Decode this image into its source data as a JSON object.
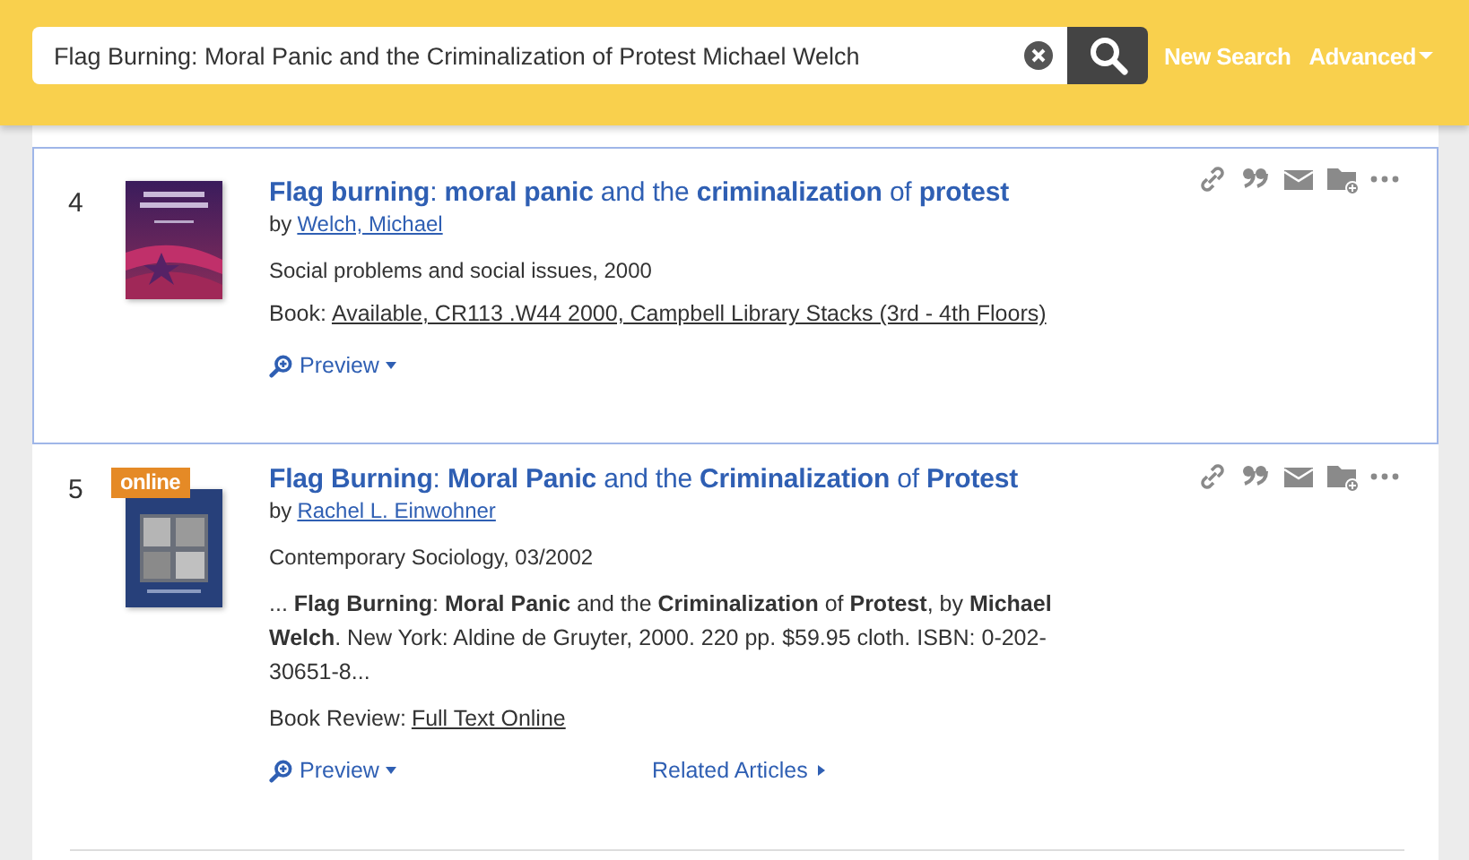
{
  "search": {
    "value": "Flag Burning: Moral Panic and the Criminalization of Protest Michael Welch"
  },
  "header_links": [
    {
      "label": "New Search",
      "kind": "link"
    },
    {
      "label": "Advanced",
      "kind": "dropdown"
    }
  ],
  "results": [
    {
      "number": "4",
      "selected": true,
      "cover": {
        "kind": "picture"
      },
      "title": "**Flag burning**: **moral panic** and the **criminalization** of **protest**",
      "by": "by",
      "author": "Welch, Michael",
      "source": "Social problems and social issues, 2000",
      "availability_label": "Book:",
      "availability": "Available, CR113 .W44 2000, Campbell Library Stacks (3rd - 4th Floors)",
      "actions": [
        {
          "label": "Preview",
          "kind": "preview"
        }
      ]
    },
    {
      "number": "5",
      "selected": false,
      "badge": "online",
      "cover": {
        "kind": "picture"
      },
      "title": "**Flag Burning**: **Moral Panic** and the **Criminalization** of **Protest**",
      "by": "by",
      "author": "Rachel L. Einwohner",
      "source": "Contemporary Sociology, 03/2002",
      "snippet": "...  **Flag Burning**: **Moral Panic** and the **Criminalization** of **Protest**, by **Michael Welch**. New York: Aldine de Gruyter, 2000. 220 pp. $59.95 cloth. ISBN: 0-202-30651-8...",
      "availability_label": "Book Review:",
      "availability": "Full Text Online",
      "actions": [
        {
          "label": "Preview",
          "kind": "preview"
        },
        {
          "label": "Related Articles",
          "kind": "related"
        }
      ]
    }
  ]
}
